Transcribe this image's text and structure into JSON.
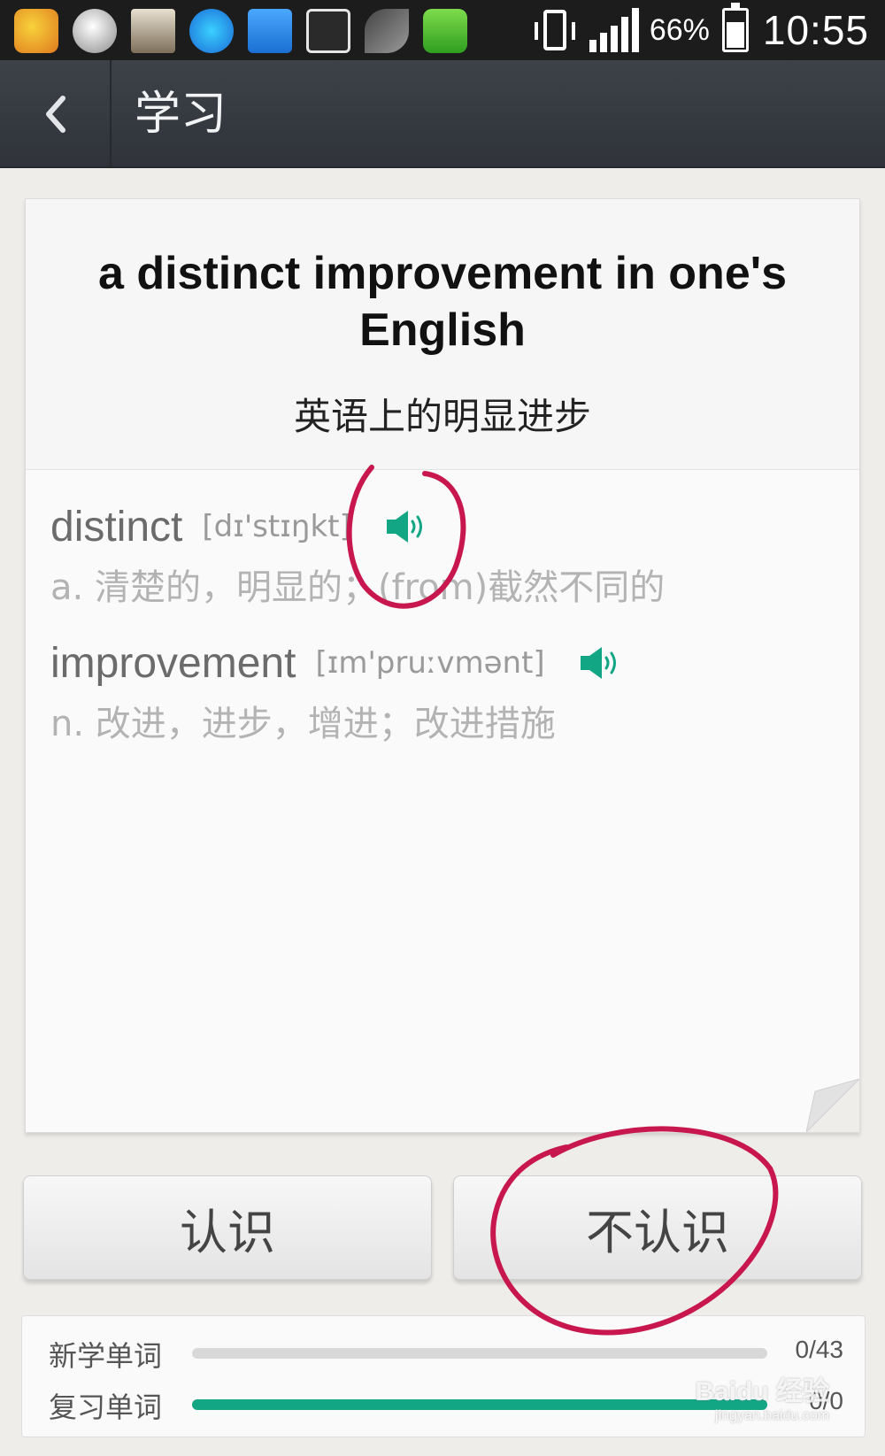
{
  "status_bar": {
    "battery_percent": "66%",
    "time": "10:55",
    "apps": [
      "app-icon-1",
      "app-icon-2",
      "app-icon-3",
      "app-icon-4",
      "app-icon-5",
      "app-icon-6",
      "app-icon-7",
      "app-icon-8"
    ]
  },
  "header": {
    "back_icon": "chevron-left-icon",
    "title": "学习"
  },
  "card": {
    "phrase": "a distinct improvement in one's English",
    "phrase_translation": "英语上的明显进步",
    "words": [
      {
        "term": "distinct",
        "phonetic": "[dɪ'stɪŋkt]",
        "definition": "a. 清楚的，明显的；(from)截然不同的",
        "icon": "speaker-icon"
      },
      {
        "term": "improvement",
        "phonetic": "[ɪm'pruːvmənt]",
        "definition": "n. 改进，进步，增进；改进措施",
        "icon": "speaker-icon"
      }
    ]
  },
  "buttons": {
    "know_label": "认识",
    "dont_know_label": "不认识"
  },
  "progress": {
    "new_words": {
      "label": "新学单词",
      "count": "0/43",
      "fraction": 0.0
    },
    "review_words": {
      "label": "复习单词",
      "count": "0/0",
      "fraction": 1.0
    }
  },
  "watermark": {
    "logo_text": "Baidu 经验",
    "url": "jingyan.baidu.com"
  },
  "colors": {
    "accent": "#13a685",
    "annotation": "#c8174e",
    "header_bg": "#373a40"
  }
}
